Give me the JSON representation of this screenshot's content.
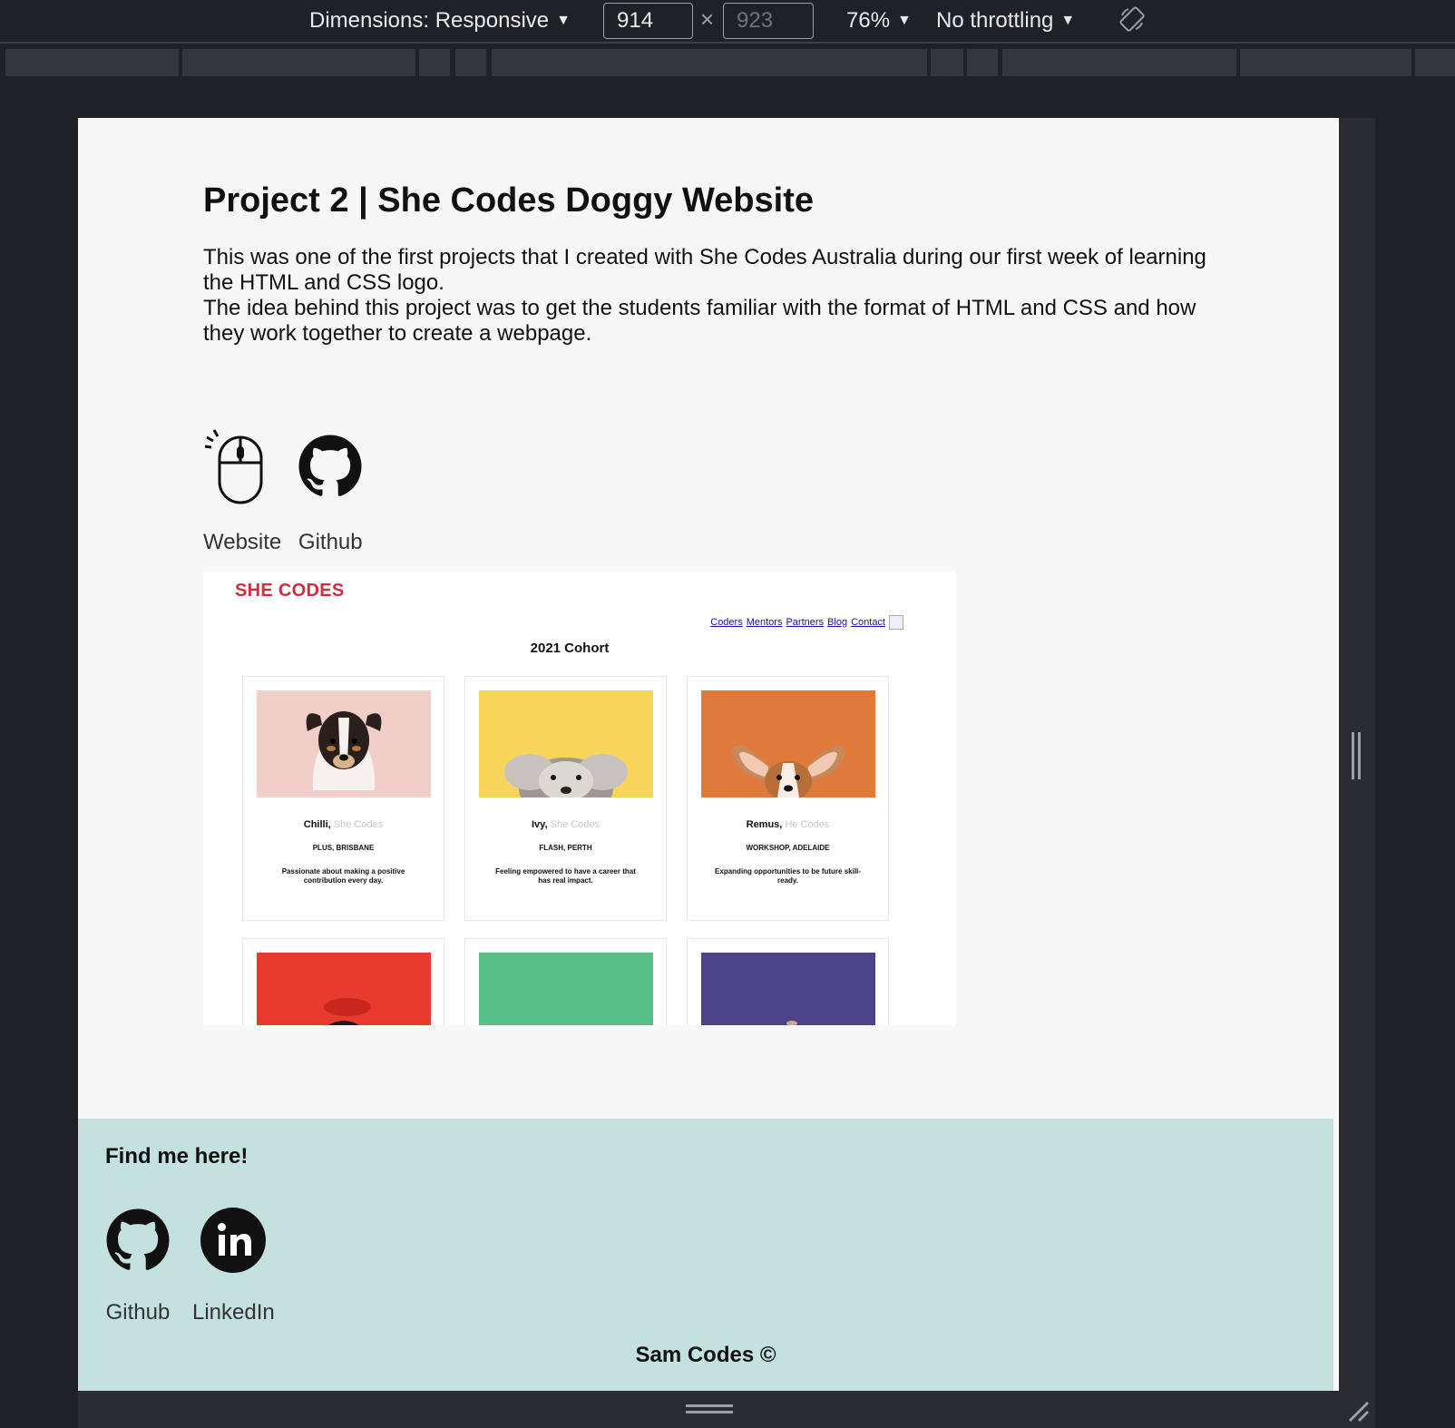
{
  "devtools": {
    "dimensions_label": "Dimensions: Responsive",
    "width_value": "914",
    "height_value": "923",
    "times_symbol": "×",
    "zoom_label": "76%",
    "throttling_label": "No throttling",
    "caret": "▼"
  },
  "project": {
    "title": "Project 2 | She Codes Doggy Website",
    "description_line1": "This was one of the first projects that I created with She Codes Australia during our first week of learning the HTML and CSS logo.",
    "description_line2": "The idea behind this project was to get the students familiar with the format of HTML and CSS and how they work together to create a webpage.",
    "links": [
      {
        "label": "Website",
        "icon": "mouse-click-icon"
      },
      {
        "label": "Github",
        "icon": "github-icon"
      }
    ]
  },
  "preview": {
    "logo": "SHE CODES",
    "nav": [
      "Coders",
      "Mentors",
      "Partners",
      "Blog",
      "Contact"
    ],
    "cohort_title": "2021 Cohort",
    "cards": [
      {
        "name": "Chilli,",
        "org": "She Codes",
        "location": "PLUS, BRISBANE",
        "quote": "Passionate about making a positive contribution every day.",
        "bg": "#efcfc8"
      },
      {
        "name": "Ivy,",
        "org": "She Codes",
        "location": "FLASH, PERTH",
        "quote": "Feeling empowered to have a career that has real impact.",
        "bg": "#f7d55a"
      },
      {
        "name": "Remus,",
        "org": "He Codes",
        "location": "WORKSHOP, ADELAIDE",
        "quote": "Expanding opportunities to be future skill-ready.",
        "bg": "#e07a3c"
      },
      {
        "bg": "#e63b2e"
      },
      {
        "bg": "#58c088"
      },
      {
        "bg": "#4c4388"
      }
    ],
    "brand_color": "#d22c3f"
  },
  "footer": {
    "heading": "Find me here!",
    "links": [
      {
        "label": "Github",
        "icon": "github-icon"
      },
      {
        "label": "LinkedIn",
        "icon": "linkedin-icon"
      }
    ],
    "copyright": "Sam Codes ©",
    "background": "#c4e0df"
  }
}
